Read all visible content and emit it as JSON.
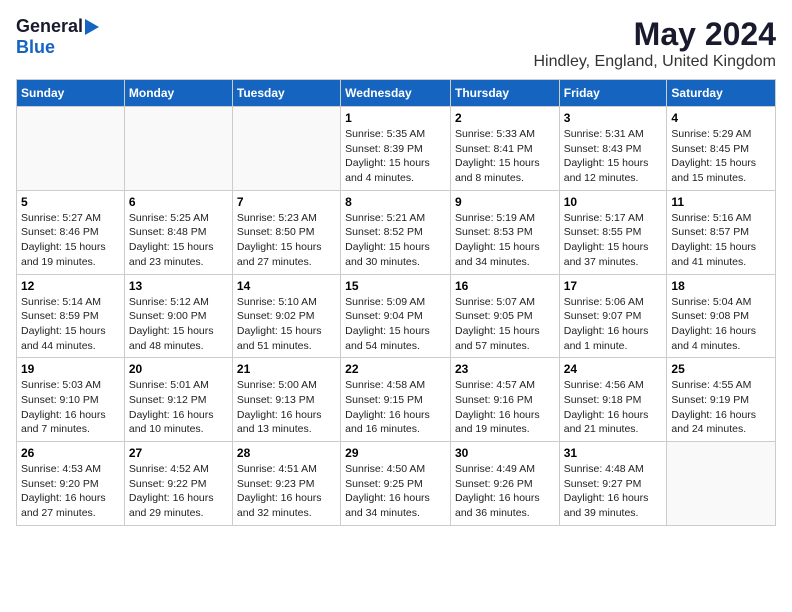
{
  "logo": {
    "general": "General",
    "blue": "Blue"
  },
  "title": "May 2024",
  "subtitle": "Hindley, England, United Kingdom",
  "weekdays": [
    "Sunday",
    "Monday",
    "Tuesday",
    "Wednesday",
    "Thursday",
    "Friday",
    "Saturday"
  ],
  "weeks": [
    [
      {
        "day": "",
        "info": ""
      },
      {
        "day": "",
        "info": ""
      },
      {
        "day": "",
        "info": ""
      },
      {
        "day": "1",
        "info": "Sunrise: 5:35 AM\nSunset: 8:39 PM\nDaylight: 15 hours\nand 4 minutes."
      },
      {
        "day": "2",
        "info": "Sunrise: 5:33 AM\nSunset: 8:41 PM\nDaylight: 15 hours\nand 8 minutes."
      },
      {
        "day": "3",
        "info": "Sunrise: 5:31 AM\nSunset: 8:43 PM\nDaylight: 15 hours\nand 12 minutes."
      },
      {
        "day": "4",
        "info": "Sunrise: 5:29 AM\nSunset: 8:45 PM\nDaylight: 15 hours\nand 15 minutes."
      }
    ],
    [
      {
        "day": "5",
        "info": "Sunrise: 5:27 AM\nSunset: 8:46 PM\nDaylight: 15 hours\nand 19 minutes."
      },
      {
        "day": "6",
        "info": "Sunrise: 5:25 AM\nSunset: 8:48 PM\nDaylight: 15 hours\nand 23 minutes."
      },
      {
        "day": "7",
        "info": "Sunrise: 5:23 AM\nSunset: 8:50 PM\nDaylight: 15 hours\nand 27 minutes."
      },
      {
        "day": "8",
        "info": "Sunrise: 5:21 AM\nSunset: 8:52 PM\nDaylight: 15 hours\nand 30 minutes."
      },
      {
        "day": "9",
        "info": "Sunrise: 5:19 AM\nSunset: 8:53 PM\nDaylight: 15 hours\nand 34 minutes."
      },
      {
        "day": "10",
        "info": "Sunrise: 5:17 AM\nSunset: 8:55 PM\nDaylight: 15 hours\nand 37 minutes."
      },
      {
        "day": "11",
        "info": "Sunrise: 5:16 AM\nSunset: 8:57 PM\nDaylight: 15 hours\nand 41 minutes."
      }
    ],
    [
      {
        "day": "12",
        "info": "Sunrise: 5:14 AM\nSunset: 8:59 PM\nDaylight: 15 hours\nand 44 minutes."
      },
      {
        "day": "13",
        "info": "Sunrise: 5:12 AM\nSunset: 9:00 PM\nDaylight: 15 hours\nand 48 minutes."
      },
      {
        "day": "14",
        "info": "Sunrise: 5:10 AM\nSunset: 9:02 PM\nDaylight: 15 hours\nand 51 minutes."
      },
      {
        "day": "15",
        "info": "Sunrise: 5:09 AM\nSunset: 9:04 PM\nDaylight: 15 hours\nand 54 minutes."
      },
      {
        "day": "16",
        "info": "Sunrise: 5:07 AM\nSunset: 9:05 PM\nDaylight: 15 hours\nand 57 minutes."
      },
      {
        "day": "17",
        "info": "Sunrise: 5:06 AM\nSunset: 9:07 PM\nDaylight: 16 hours\nand 1 minute."
      },
      {
        "day": "18",
        "info": "Sunrise: 5:04 AM\nSunset: 9:08 PM\nDaylight: 16 hours\nand 4 minutes."
      }
    ],
    [
      {
        "day": "19",
        "info": "Sunrise: 5:03 AM\nSunset: 9:10 PM\nDaylight: 16 hours\nand 7 minutes."
      },
      {
        "day": "20",
        "info": "Sunrise: 5:01 AM\nSunset: 9:12 PM\nDaylight: 16 hours\nand 10 minutes."
      },
      {
        "day": "21",
        "info": "Sunrise: 5:00 AM\nSunset: 9:13 PM\nDaylight: 16 hours\nand 13 minutes."
      },
      {
        "day": "22",
        "info": "Sunrise: 4:58 AM\nSunset: 9:15 PM\nDaylight: 16 hours\nand 16 minutes."
      },
      {
        "day": "23",
        "info": "Sunrise: 4:57 AM\nSunset: 9:16 PM\nDaylight: 16 hours\nand 19 minutes."
      },
      {
        "day": "24",
        "info": "Sunrise: 4:56 AM\nSunset: 9:18 PM\nDaylight: 16 hours\nand 21 minutes."
      },
      {
        "day": "25",
        "info": "Sunrise: 4:55 AM\nSunset: 9:19 PM\nDaylight: 16 hours\nand 24 minutes."
      }
    ],
    [
      {
        "day": "26",
        "info": "Sunrise: 4:53 AM\nSunset: 9:20 PM\nDaylight: 16 hours\nand 27 minutes."
      },
      {
        "day": "27",
        "info": "Sunrise: 4:52 AM\nSunset: 9:22 PM\nDaylight: 16 hours\nand 29 minutes."
      },
      {
        "day": "28",
        "info": "Sunrise: 4:51 AM\nSunset: 9:23 PM\nDaylight: 16 hours\nand 32 minutes."
      },
      {
        "day": "29",
        "info": "Sunrise: 4:50 AM\nSunset: 9:25 PM\nDaylight: 16 hours\nand 34 minutes."
      },
      {
        "day": "30",
        "info": "Sunrise: 4:49 AM\nSunset: 9:26 PM\nDaylight: 16 hours\nand 36 minutes."
      },
      {
        "day": "31",
        "info": "Sunrise: 4:48 AM\nSunset: 9:27 PM\nDaylight: 16 hours\nand 39 minutes."
      },
      {
        "day": "",
        "info": ""
      }
    ]
  ]
}
